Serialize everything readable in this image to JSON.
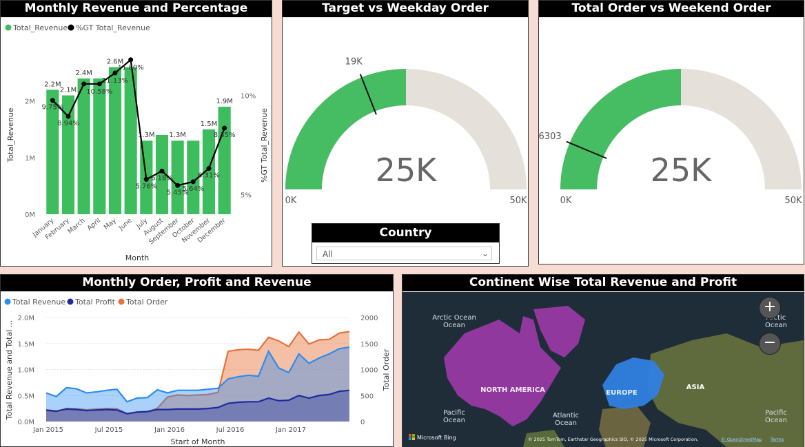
{
  "panels": {
    "monthly_revenue": {
      "title": "Monthly Revenue and Percentage"
    },
    "target_weekday": {
      "title": "Target vs Weekday Order"
    },
    "total_weekend": {
      "title": "Total Order vs Weekend Order"
    },
    "monthly_order": {
      "title": "Monthly Order, Profit and Revenue"
    },
    "continent": {
      "title": "Continent Wise Total Revenue and Profit"
    }
  },
  "slicer": {
    "title": "Country",
    "value": "All"
  },
  "chart_data": [
    {
      "type": "bar",
      "title": "Monthly Revenue and Percentage",
      "legend": [
        "Total_Revenue",
        "%GT Total_Revenue"
      ],
      "colors": {
        "bar": "#3dbd5d",
        "line": "#000000"
      },
      "xlabel": "Month",
      "ylabel": "Total_Revenue",
      "y2label": "%GT Total_Revenue",
      "categories": [
        "January",
        "February",
        "March",
        "April",
        "May",
        "June",
        "July",
        "August",
        "September",
        "October",
        "November",
        "December"
      ],
      "revenue": [
        2.2,
        2.1,
        2.4,
        2.4,
        2.6,
        2.6,
        1.3,
        1.4,
        1.3,
        1.3,
        1.5,
        1.9
      ],
      "revenue_labels": [
        "2.2M",
        "2.1M",
        "2.4M",
        "",
        "2.6M",
        "",
        "1.3M",
        "",
        "1.3M",
        "",
        "1.5M",
        "1.9M"
      ],
      "percent": [
        9.75,
        8.94,
        10.58,
        10.58,
        11.13,
        11.8,
        5.76,
        6.18,
        5.45,
        5.64,
        6.31,
        8.35
      ],
      "percent_labels": [
        "9.75%",
        "8.94%",
        "",
        "10.58%",
        "11.13%",
        "11.80%",
        "5.76%",
        "6.18%",
        "5.45%",
        "5.64%",
        "6.31%",
        "8.35%"
      ],
      "yticks": [
        "0M",
        "1M",
        "2M"
      ],
      "y2ticks": [
        "5%",
        "10%"
      ],
      "ylim": [
        0,
        2.8
      ],
      "y2lim": [
        4,
        12
      ]
    },
    {
      "type": "gauge",
      "title": "Target vs Weekday Order",
      "value": 25000,
      "value_label": "25K",
      "min_label": "0K",
      "max_label": "50K",
      "target": 19000,
      "target_label": "19K",
      "min": 0,
      "max": 50000,
      "colors": {
        "fill": "#46bd63",
        "track": "#e5e0da"
      }
    },
    {
      "type": "gauge",
      "title": "Total Order vs Weekend Order",
      "value": 25000,
      "value_label": "25K",
      "min_label": "0K",
      "max_label": "50K",
      "target": 6303,
      "target_label": "6303",
      "min": 0,
      "max": 50000,
      "colors": {
        "fill": "#46bd63",
        "track": "#e5e0da"
      }
    },
    {
      "type": "area",
      "title": "Monthly Order, Profit and Revenue",
      "legend": [
        "Total Revenue",
        "Total Profit",
        "Total Order"
      ],
      "colors": {
        "revenue": "#2b8cf0",
        "profit": "#1f2a9c",
        "order": "#e8703a"
      },
      "xlabel": "Start of Month",
      "ylabel": "Total Revenue and Total ...",
      "y2label": "Total Order",
      "x_ticks": [
        "Jan 2015",
        "Jul 2015",
        "Jan 2016",
        "Jul 2016",
        "Jan 2017"
      ],
      "yticks": [
        "0.0M",
        "0.5M",
        "1.0M",
        "1.5M",
        "2.0M"
      ],
      "y2ticks": [
        "0",
        "500",
        "1000",
        "1500",
        "2000"
      ],
      "ylim": [
        0,
        2.0
      ],
      "y2lim": [
        0,
        2000
      ],
      "series": [
        {
          "name": "Total Revenue",
          "axis": "left",
          "values": [
            0.55,
            0.48,
            0.65,
            0.63,
            0.55,
            0.57,
            0.6,
            0.62,
            0.38,
            0.45,
            0.46,
            0.61,
            0.55,
            0.6,
            0.6,
            0.6,
            0.62,
            0.64,
            0.82,
            0.86,
            0.89,
            0.87,
            1.35,
            1.03,
            0.94,
            1.3,
            1.12,
            1.22,
            1.3,
            1.4,
            1.43
          ]
        },
        {
          "name": "Total Profit",
          "axis": "left",
          "values": [
            0.22,
            0.2,
            0.24,
            0.23,
            0.21,
            0.22,
            0.23,
            0.22,
            0.15,
            0.18,
            0.19,
            0.23,
            0.23,
            0.24,
            0.24,
            0.24,
            0.25,
            0.27,
            0.35,
            0.37,
            0.38,
            0.38,
            0.45,
            0.4,
            0.41,
            0.5,
            0.45,
            0.5,
            0.52,
            0.58,
            0.6
          ]
        },
        {
          "name": "Total Order",
          "axis": "right",
          "values": [
            210,
            190,
            250,
            245,
            225,
            240,
            250,
            245,
            150,
            185,
            190,
            255,
            470,
            510,
            500,
            510,
            520,
            560,
            1350,
            1380,
            1390,
            1370,
            1620,
            1550,
            1440,
            1720,
            1490,
            1570,
            1580,
            1700,
            1730
          ]
        }
      ]
    }
  ],
  "map": {
    "labels": {
      "arctic_ocean_left": "Arctic\nOcean",
      "arctic_ocean_right": "Arctic\nOcean",
      "north_america": "NORTH AMERICA",
      "europe": "EUROPE",
      "asia": "ASIA",
      "pacific_left": "Pacific\nOcean",
      "atlantic": "Atlantic\nOcean",
      "pacific_right": "Pacific\nOcean"
    },
    "brand": "Microsoft Bing",
    "attribution": "© 2025 TomTom, Earthstar Geographics SIO, © 2025 Microsoft Corporation,",
    "osm_link": "© OpenStreetMap",
    "terms_link": "Terms",
    "zoom_in": "+",
    "zoom_out": "−",
    "colors": {
      "north_america": "#9b3aa8",
      "europe": "#2f7fe0"
    }
  }
}
